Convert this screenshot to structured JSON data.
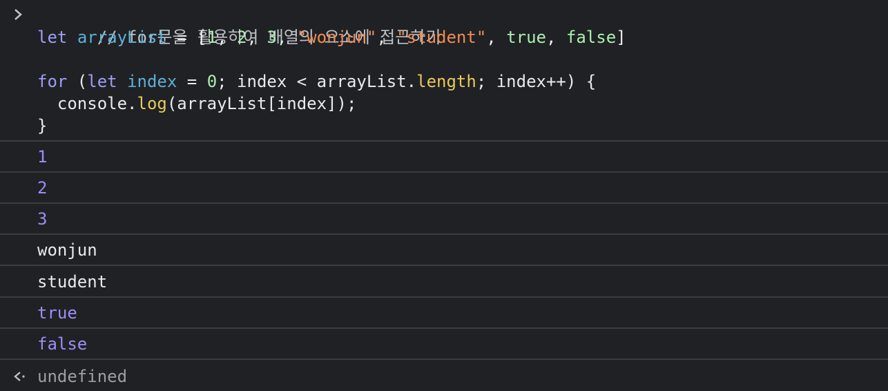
{
  "code": {
    "comment": "// for문을 활용하여 배열의 요소에 접근하기",
    "line2": {
      "kw_let": "let",
      "var_name": "arrayList",
      "eq": " = [",
      "n1": "1",
      "c1": ", ",
      "n2": "2",
      "c2": ", ",
      "n3": "3",
      "c3": ", ",
      "s1": "\"wonjun\"",
      "c4": ", ",
      "s2": "\"student\"",
      "c5": ", ",
      "b1": "true",
      "c6": ", ",
      "b2": "false",
      "close": "]"
    },
    "line4": {
      "kw_for": "for",
      "paren_open": " (",
      "kw_let": "let",
      "space": " ",
      "var_index": "index",
      "eq": " = ",
      "zero": "0",
      "middle": "; index < arrayList.",
      "prop_length": "length",
      "end": "; index++) {"
    },
    "line5": {
      "pre": "  console.",
      "fn_log": "log",
      "post": "(arrayList[index]);"
    },
    "line6": "}"
  },
  "outputs": [
    {
      "text": "1",
      "kind": "number"
    },
    {
      "text": "2",
      "kind": "number"
    },
    {
      "text": "3",
      "kind": "number"
    },
    {
      "text": "wonjun",
      "kind": "string"
    },
    {
      "text": "student",
      "kind": "string"
    },
    {
      "text": "true",
      "kind": "bool"
    },
    {
      "text": "false",
      "kind": "bool"
    }
  ],
  "result": {
    "text": "undefined",
    "icon": "return-arrow-icon"
  },
  "prompt": {
    "icon": "chevron-right-icon"
  },
  "colors": {
    "background": "#202124",
    "divider": "#3c3c3c",
    "keyword": "#9e9ef5",
    "variable": "#5db0d7",
    "string": "#f28b54",
    "literal": "#a8f0b0",
    "property": "#e8c95a",
    "output_number": "#9e8cf5"
  }
}
